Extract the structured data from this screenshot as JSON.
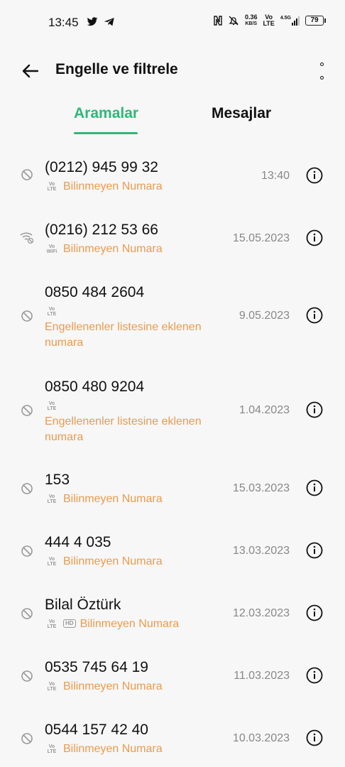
{
  "status_bar": {
    "time": "13:45",
    "speed": "0.36",
    "speed_unit": "KB/S",
    "volte_top": "Vo",
    "volte_bottom": "LTE",
    "network": "4.5G",
    "battery": "79",
    "icons": [
      "twitter-icon",
      "telegram-icon",
      "nfc-icon",
      "mute-icon",
      "signal-icon"
    ]
  },
  "header": {
    "title": "Engelle ve filtrele"
  },
  "tabs": [
    {
      "label": "Aramalar",
      "active": true
    },
    {
      "label": "Mesajlar",
      "active": false
    }
  ],
  "colors": {
    "accent": "#2eb878",
    "label": "#ec9a4d",
    "date": "#888888"
  },
  "calls": [
    {
      "number": "(0212) 945 99 32",
      "badge": "Vo LTE",
      "label": "Bilinmeyen Numara",
      "date": "13:40",
      "icon": "blocked-icon"
    },
    {
      "number": "(0216) 212 53 66",
      "badge": "Vo WiFi",
      "label": "Bilinmeyen Numara",
      "date": "15.05.2023",
      "icon": "wifi-call-icon"
    },
    {
      "number": "0850 484 2604",
      "badge": "Vo LTE",
      "label": "Engellenenler listesine eklenen numara",
      "date": "9.05.2023",
      "icon": "blocked-icon"
    },
    {
      "number": "0850 480 9204",
      "badge": "Vo LTE",
      "label": "Engellenenler listesine eklenen numara",
      "date": "1.04.2023",
      "icon": "blocked-icon"
    },
    {
      "number": "153",
      "badge": "Vo LTE",
      "label": "Bilinmeyen Numara",
      "date": "15.03.2023",
      "icon": "blocked-icon"
    },
    {
      "number": "444 4 035",
      "badge": "Vo LTE",
      "label": "Bilinmeyen Numara",
      "date": "13.03.2023",
      "icon": "blocked-icon"
    },
    {
      "number": "Bilal Öztürk",
      "badge": "Vo LTE",
      "hd": "HD",
      "label": "Bilinmeyen Numara",
      "date": "12.03.2023",
      "icon": "blocked-icon"
    },
    {
      "number": "0535 745 64 19",
      "badge": "Vo LTE",
      "label": "Bilinmeyen Numara",
      "date": "11.03.2023",
      "icon": "blocked-icon"
    },
    {
      "number": "0544 157 42 40",
      "badge": "Vo LTE",
      "label": "Bilinmeyen Numara",
      "date": "10.03.2023",
      "icon": "blocked-icon"
    }
  ]
}
